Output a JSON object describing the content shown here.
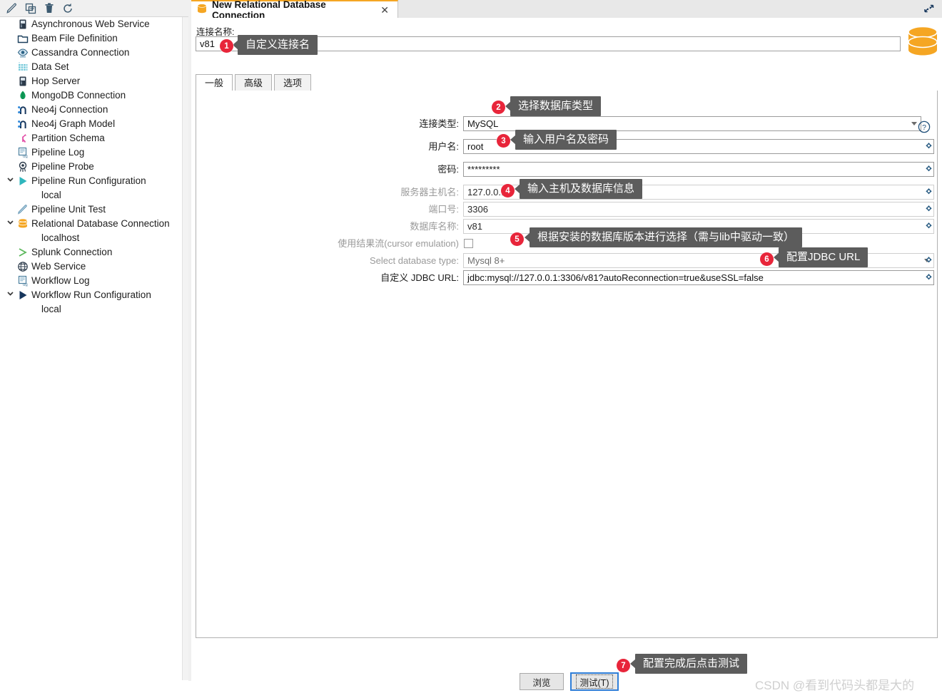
{
  "toolbar": {
    "icons": [
      {
        "name": "edit-icon",
        "label": "Edit"
      },
      {
        "name": "duplicate-icon",
        "label": "Duplicate"
      },
      {
        "name": "delete-icon",
        "label": "Delete"
      },
      {
        "name": "refresh-icon",
        "label": "Refresh"
      }
    ]
  },
  "tree": {
    "items": [
      {
        "label": "Asynchronous Web Service",
        "icon": "server-icon",
        "twisty": "",
        "child": false
      },
      {
        "label": "Beam File Definition",
        "icon": "folder-icon",
        "twisty": "",
        "child": false
      },
      {
        "label": "Cassandra Connection",
        "icon": "eye-icon",
        "twisty": "",
        "child": false
      },
      {
        "label": "Data Set",
        "icon": "grid-icon",
        "twisty": "",
        "child": false
      },
      {
        "label": "Hop Server",
        "icon": "server-icon",
        "twisty": "",
        "child": false
      },
      {
        "label": "MongoDB Connection",
        "icon": "leaf-icon",
        "twisty": "",
        "child": false
      },
      {
        "label": "Neo4j Connection",
        "icon": "neo4j-icon",
        "twisty": "",
        "child": false
      },
      {
        "label": "Neo4j Graph Model",
        "icon": "neo4j-icon",
        "twisty": "",
        "child": false
      },
      {
        "label": "Partition Schema",
        "icon": "partition-icon",
        "twisty": "",
        "child": false
      },
      {
        "label": "Pipeline Log",
        "icon": "log-icon",
        "twisty": "",
        "child": false
      },
      {
        "label": "Pipeline Probe",
        "icon": "probe-icon",
        "twisty": "",
        "child": false
      },
      {
        "label": "Pipeline Run Configuration",
        "icon": "play-teal-icon",
        "twisty": "chevron-down-icon",
        "child": false
      },
      {
        "label": "local",
        "icon": "",
        "twisty": "",
        "child": true
      },
      {
        "label": "Pipeline Unit Test",
        "icon": "pencil-icon",
        "twisty": "",
        "child": false
      },
      {
        "label": "Relational Database Connection",
        "icon": "database-icon",
        "twisty": "chevron-down-icon",
        "child": false
      },
      {
        "label": "localhost",
        "icon": "",
        "twisty": "",
        "child": true
      },
      {
        "label": "Splunk Connection",
        "icon": "splunk-icon",
        "twisty": "",
        "child": false
      },
      {
        "label": "Web Service",
        "icon": "globe-icon",
        "twisty": "",
        "child": false
      },
      {
        "label": "Workflow Log",
        "icon": "log-icon",
        "twisty": "",
        "child": false
      },
      {
        "label": "Workflow Run Configuration",
        "icon": "play-navy-icon",
        "twisty": "chevron-down-icon",
        "child": false
      },
      {
        "label": "local",
        "icon": "",
        "twisty": "",
        "child": true
      }
    ]
  },
  "dialog": {
    "tab_title": "New Relational Database Connection",
    "close_label": "✕",
    "restore_label": "restore-icon",
    "connection_name_label": "连接名称:",
    "connection_name_value": "v81",
    "tabs": [
      {
        "label": "一般",
        "active": true
      },
      {
        "label": "高级",
        "active": false
      },
      {
        "label": "选项",
        "active": false
      }
    ],
    "fields": {
      "connection_type_label": "连接类型:",
      "connection_type_value": "MySQL",
      "username_label": "用户名:",
      "username_value": "root",
      "password_label": "密码:",
      "password_value": "*********",
      "host_label": "服务器主机名:",
      "host_value": "127.0.0.1",
      "port_label": "端口号:",
      "port_value": "3306",
      "dbname_label": "数据库名称:",
      "dbname_value": "v81",
      "cursor_label": "使用结果流(cursor emulation)",
      "dbtype_label": "Select database type:",
      "dbtype_value": "Mysql 8+",
      "jdbc_label": "自定义 JDBC URL:",
      "jdbc_value": "jdbc:mysql://127.0.0.1:3306/v81?autoReconnection=true&useSSL=false"
    },
    "help_icon": "help-icon",
    "buttons": {
      "browse": "浏览",
      "test": "测试(T)"
    }
  },
  "callouts": [
    {
      "num": "1",
      "text": "自定义连接名"
    },
    {
      "num": "2",
      "text": "选择数据库类型"
    },
    {
      "num": "3",
      "text": "输入用户名及密码"
    },
    {
      "num": "4",
      "text": "输入主机及数据库信息"
    },
    {
      "num": "5",
      "text": "根据安装的数据库版本进行选择（需与lib中驱动一致）"
    },
    {
      "num": "6",
      "text": "配置JDBC URL"
    },
    {
      "num": "7",
      "text": "配置完成后点击测试"
    }
  ],
  "watermark": "CSDN @看到代码头都是大的",
  "colors": {
    "accent_orange": "#f5a623",
    "badge_red": "#e8253a",
    "tooltip_gray": "#5c5c5c",
    "focus_blue": "#2f7ed8"
  }
}
